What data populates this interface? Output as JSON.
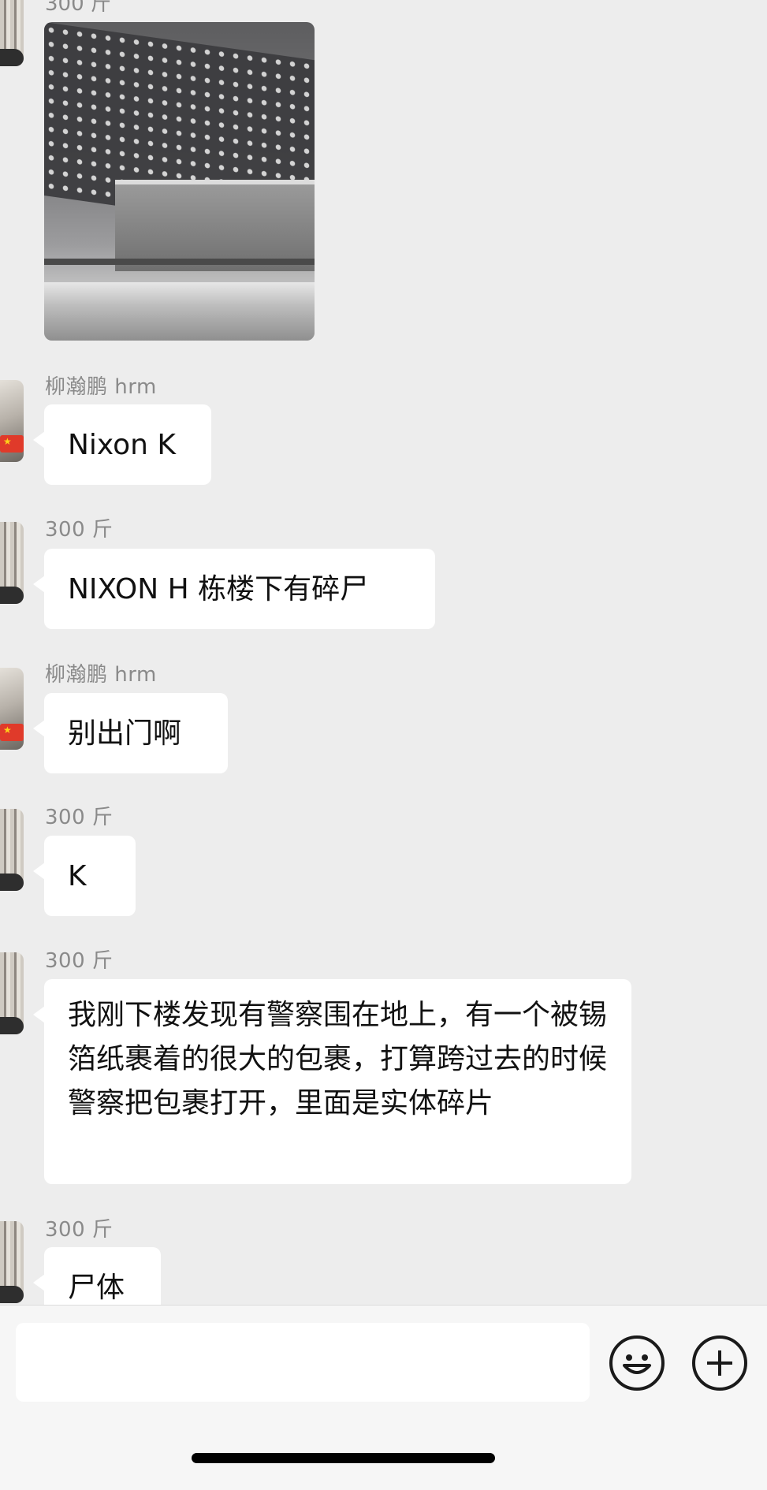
{
  "chat": {
    "top_sender": "300 斤",
    "messages": [
      {
        "sender": "柳瀚鹏 hrm",
        "text": "Nixon K"
      },
      {
        "sender": "300 斤",
        "text": "NIXON H 栋楼下有碎尸"
      },
      {
        "sender": "柳瀚鹏 hrm",
        "text": "别出门啊"
      },
      {
        "sender": "300 斤",
        "text": "K"
      },
      {
        "sender": "300 斤",
        "text": "我刚下楼发现有警察围在地上，有一个被锡箔纸裹着的很大的包裹，打算跨过去的时候警察把包裹打开，里面是实体碎片"
      },
      {
        "sender": "300 斤",
        "text": "尸体"
      }
    ]
  },
  "input": {
    "placeholder": "",
    "emoji_icon": "smiley-face-icon",
    "plus_icon": "plus-circle-icon"
  }
}
